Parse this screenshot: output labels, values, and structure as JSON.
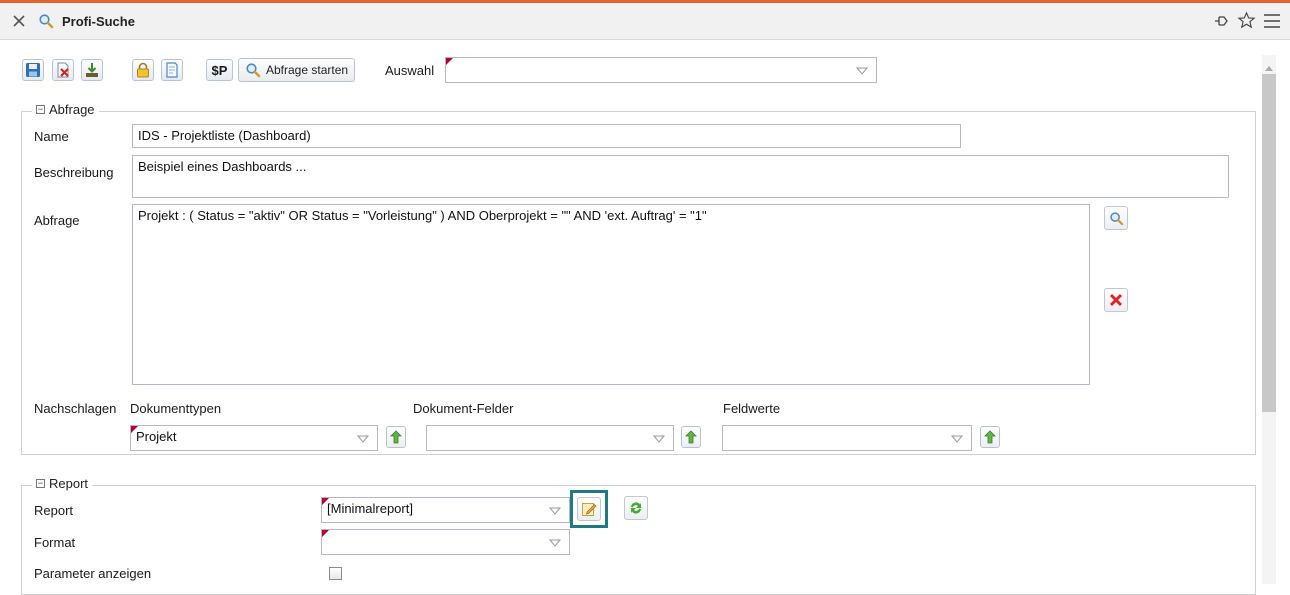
{
  "window": {
    "title": "Profi-Suche"
  },
  "toolbar": {
    "dollar_p_label": "$P",
    "run_query_label": "Abfrage starten",
    "selection_label": "Auswahl",
    "selection_value": ""
  },
  "abfrage_section": {
    "legend": "Abfrage",
    "name_label": "Name",
    "name_value": "IDS - Projektliste (Dashboard)",
    "description_label": "Beschreibung",
    "description_value": "Beispiel eines Dashboards ...",
    "query_label": "Abfrage",
    "query_value": "Projekt : ( Status = \"aktiv\" OR Status = \"Vorleistung\" ) AND Oberprojekt = \"\" AND 'ext. Auftrag' = \"1\"",
    "lookup_label": "Nachschlagen",
    "doctypes_label": "Dokumenttypen",
    "doctypes_value": "Projekt",
    "docfields_label": "Dokument-Felder",
    "docfields_value": "",
    "fieldvalues_label": "Feldwerte",
    "fieldvalues_value": ""
  },
  "report_section": {
    "legend": "Report",
    "report_label": "Report",
    "report_value": "[Minimalreport]",
    "format_label": "Format",
    "format_value": "",
    "show_params_label": "Parameter anzeigen",
    "show_params_checked": false
  },
  "colors": {
    "accent_line": "#e2632d",
    "highlight_border": "#1f7a80",
    "required_marker": "#b8002e"
  }
}
